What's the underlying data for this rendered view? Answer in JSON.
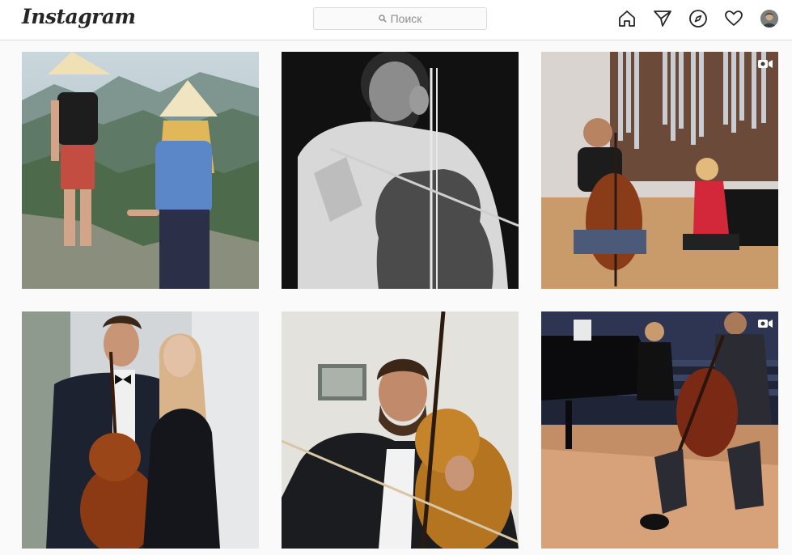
{
  "header": {
    "logo": "Instagram",
    "search_placeholder": "Поиск",
    "icons": [
      "home-icon",
      "direct-icon",
      "explore-icon",
      "activity-heart-icon",
      "profile-avatar"
    ]
  },
  "posts": [
    {
      "subject": "couple-conical-hats-mountains",
      "video": false
    },
    {
      "subject": "cellist-bw-portrait",
      "video": false
    },
    {
      "subject": "cellist-pianist-organ-hall",
      "video": true
    },
    {
      "subject": "couple-cello-formal-wear",
      "video": false
    },
    {
      "subject": "cellist-bow-closeup",
      "video": false
    },
    {
      "subject": "pianist-cellist-concert-hall",
      "video": true
    }
  ],
  "colors": {
    "border": "#dbdbdb",
    "text": "#262626",
    "muted": "#8e8e8e",
    "background": "#fafafa"
  }
}
